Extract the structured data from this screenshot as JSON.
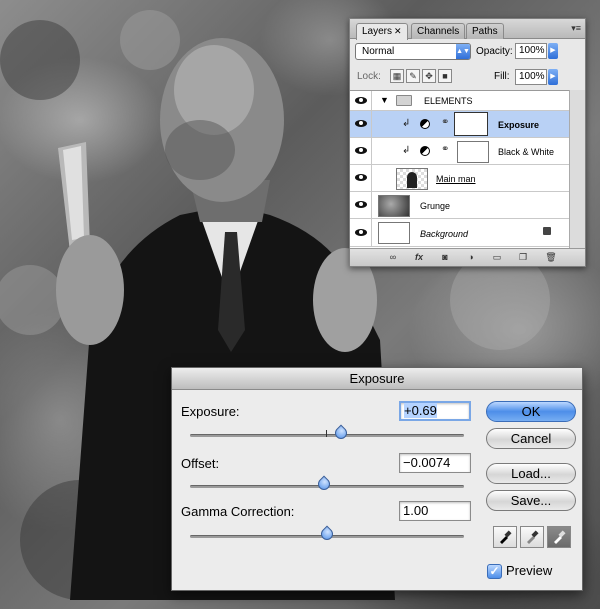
{
  "layers_panel": {
    "tabs": [
      {
        "label": "Layers",
        "close": "✕"
      },
      {
        "label": "Channels"
      },
      {
        "label": "Paths"
      }
    ],
    "blend_mode": "Normal",
    "opacity_label": "Opacity:",
    "opacity_value": "100%",
    "lock_label": "Lock:",
    "fill_label": "Fill:",
    "fill_value": "100%",
    "layers": [
      {
        "name": "ELEMENTS",
        "kind": "group",
        "expanded": true
      },
      {
        "name": "Exposure",
        "kind": "adjustment",
        "selected": true,
        "clipped": true
      },
      {
        "name": "Black & White",
        "kind": "adjustment",
        "clipped": true
      },
      {
        "name": "Main man",
        "kind": "pixel"
      },
      {
        "name": "Grunge",
        "kind": "pixel"
      },
      {
        "name": "Background",
        "kind": "background",
        "locked": true
      }
    ],
    "footer_icons": [
      "link-icon",
      "fx-icon",
      "mask-icon",
      "adjustment-icon",
      "folder-icon",
      "new-layer-icon",
      "trash-icon"
    ]
  },
  "exposure_dialog": {
    "title": "Exposure",
    "exposure": {
      "label": "Exposure:",
      "value": "+0.69",
      "slider": 0.55
    },
    "offset": {
      "label": "Offset:",
      "value": "−0.0074",
      "slider": 0.49
    },
    "gamma": {
      "label": "Gamma Correction:",
      "value": "1.00",
      "slider": 0.5
    },
    "buttons": {
      "ok": "OK",
      "cancel": "Cancel",
      "load": "Load...",
      "save": "Save..."
    },
    "eyedroppers": [
      "black-point-eyedropper-icon",
      "gray-point-eyedropper-icon",
      "white-point-eyedropper-icon"
    ],
    "preview_label": "Preview",
    "preview_checked": true
  },
  "colors": {
    "selection": "#b9d1f5",
    "accent_blue": "#4d8ee9"
  }
}
